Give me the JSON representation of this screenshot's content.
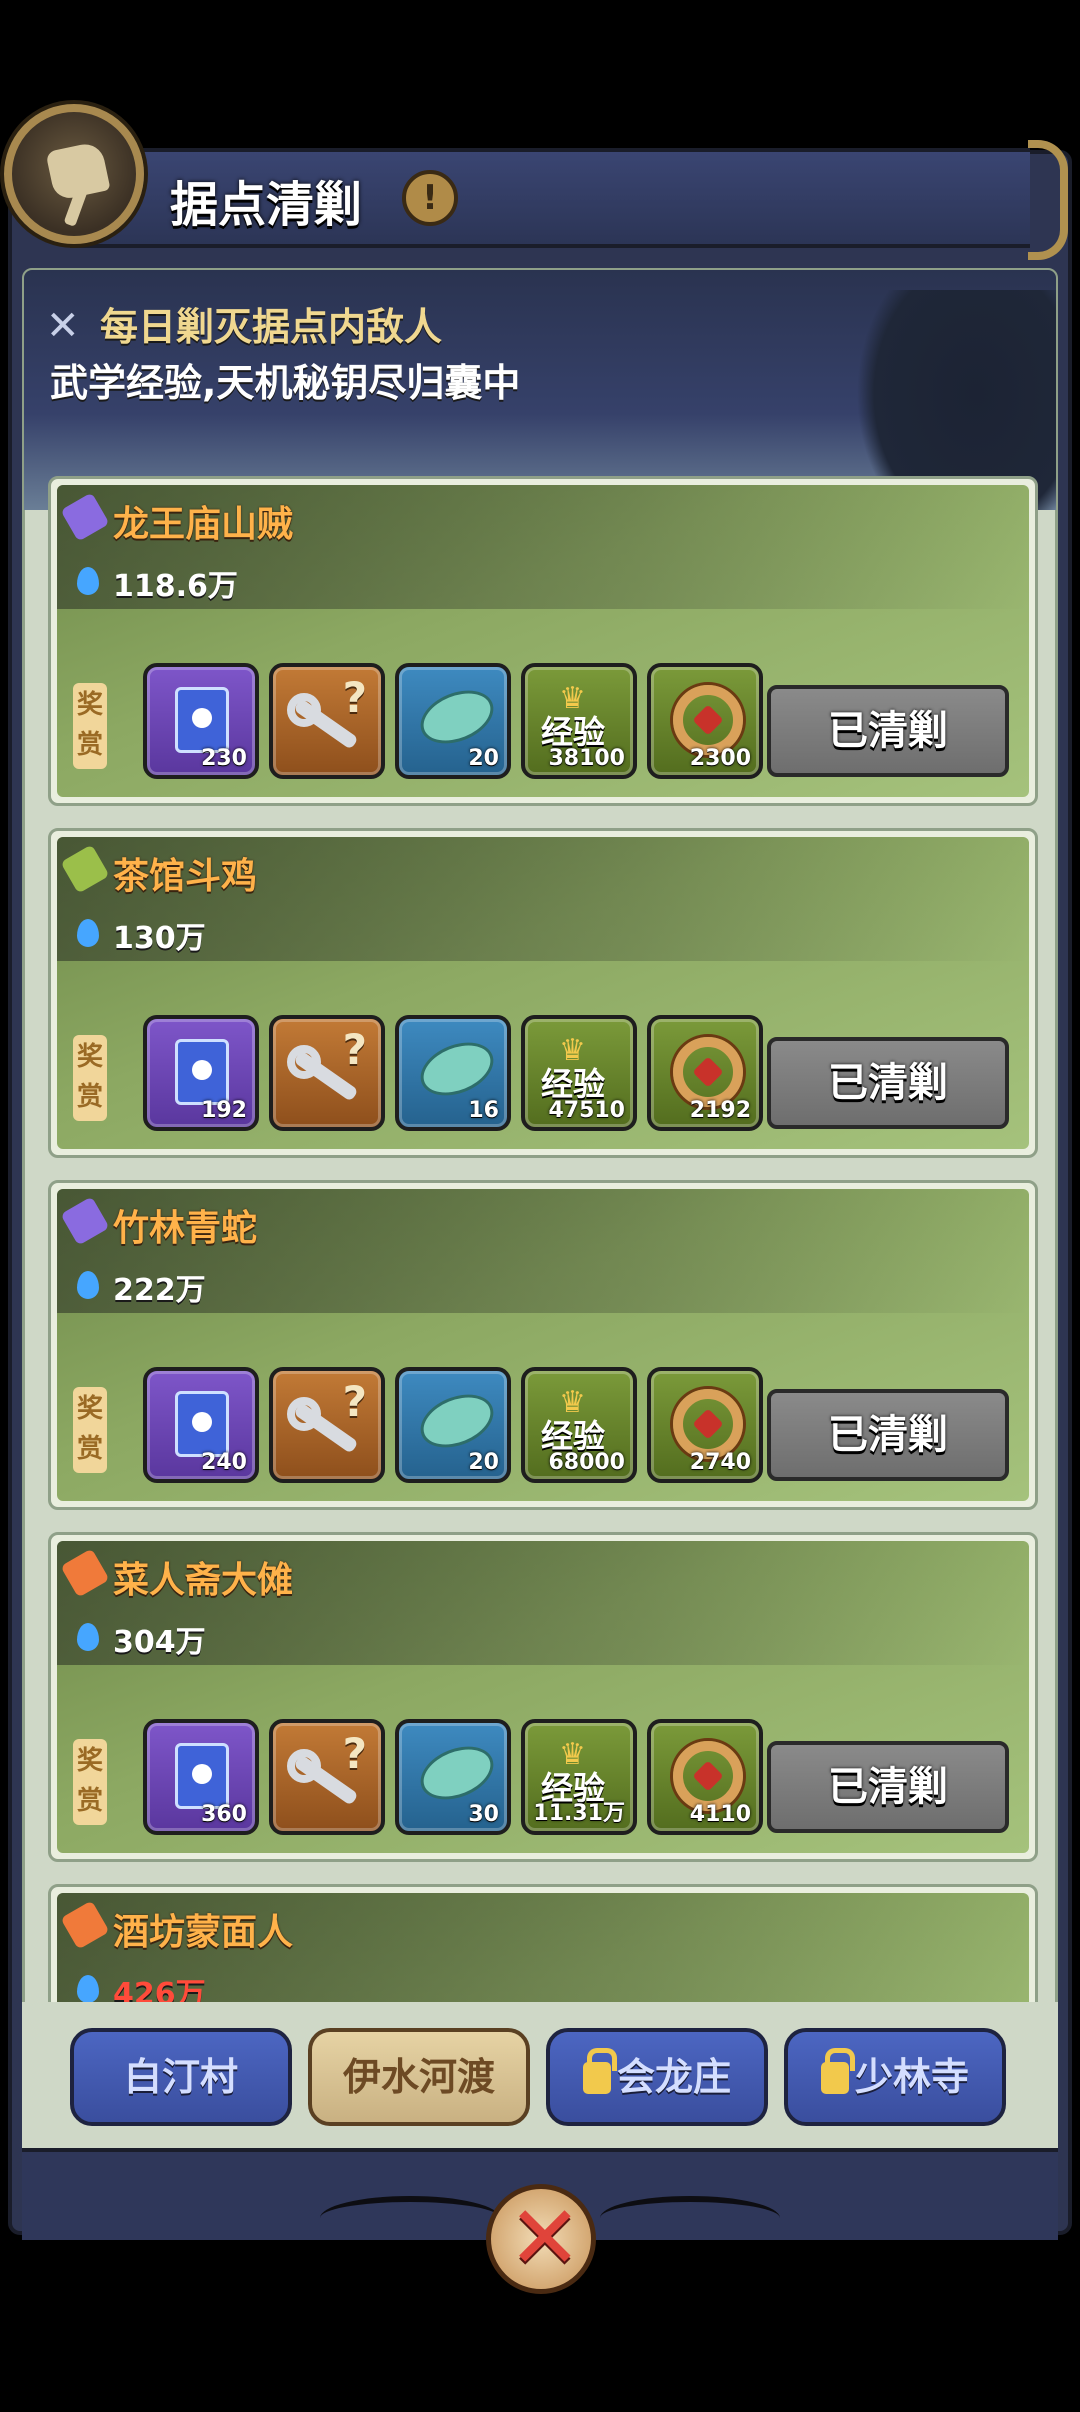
{
  "header": {
    "title": "据点清剿",
    "info_icon": "!",
    "emblem": "hammer-emblem-icon"
  },
  "banner": {
    "line1": "每日剿灭据点内敌人",
    "line2": "武学经验,天机秘钥尽归囊中",
    "icon": "x-icon"
  },
  "reward_label": "奖赏",
  "cards": [
    {
      "name": "龙王庙山贼",
      "power": "118.6万",
      "power_color": "#ffffff",
      "icon_color": "#8a6be0",
      "rewards": [
        "230",
        "",
        "20",
        "38100",
        "2300"
      ],
      "state": "已清剿"
    },
    {
      "name": "茶馆斗鸡",
      "power": "130万",
      "power_color": "#ffffff",
      "icon_color": "#9bbf4a",
      "rewards": [
        "192",
        "",
        "16",
        "47510",
        "2192"
      ],
      "state": "已清剿"
    },
    {
      "name": "竹林青蛇",
      "power": "222万",
      "power_color": "#ffffff",
      "icon_color": "#8a6be0",
      "rewards": [
        "240",
        "",
        "20",
        "68000",
        "2740"
      ],
      "state": "已清剿"
    },
    {
      "name": "菜人斋大傩",
      "power": "304万",
      "power_color": "#ffffff",
      "icon_color": "#f07a3a",
      "rewards": [
        "360",
        "",
        "30",
        "11.31万",
        "4110"
      ],
      "state": "已清剿"
    },
    {
      "name": "酒坊蒙面人",
      "power": "426万",
      "power_color": "#ff4b3a",
      "icon_color": "#f07a3a",
      "rewards": [
        "",
        "",
        "",
        "",
        ""
      ],
      "state": ""
    }
  ],
  "item_labels": {
    "exp": "经验",
    "key_mark": "?"
  },
  "tabs": [
    {
      "label": "白汀村",
      "active": false,
      "locked": false
    },
    {
      "label": "伊水河渡",
      "active": true,
      "locked": false
    },
    {
      "label": "会龙庄",
      "active": false,
      "locked": true
    },
    {
      "label": "少林寺",
      "active": false,
      "locked": true
    }
  ],
  "close_icon": "close-icon",
  "colors": {
    "accent_gold": "#f0d890",
    "name_orange": "#ffb24a",
    "tab_blue": "#4c66c2",
    "tab_active": "#e6d3a4",
    "cleared_gray": "#8a8a8a"
  }
}
